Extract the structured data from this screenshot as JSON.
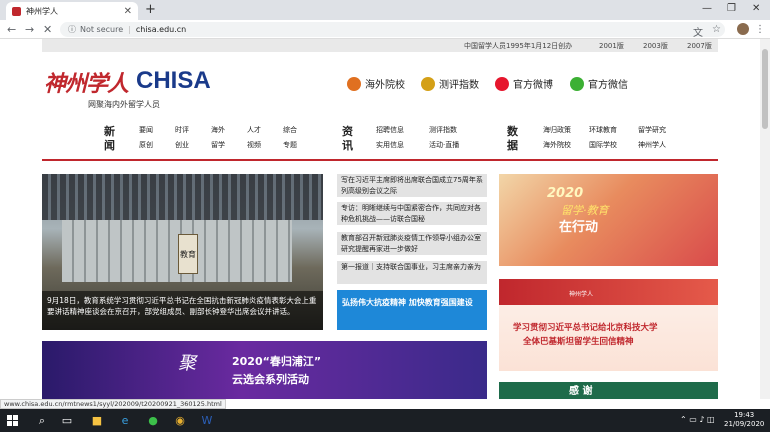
{
  "browser": {
    "tab_title": "神州学人",
    "url_secure_text": "Not secure",
    "url": "chisa.edu.cn",
    "status_url": "www.chisa.edu.cn/rmtnews1/syyl/202009/t20200921_360125.html"
  },
  "topbar": {
    "publication": "中国留学人员1995年1月12日创办",
    "versions": [
      "2001版",
      "2003版",
      "2007版"
    ]
  },
  "header": {
    "logo_cn": "神州学人",
    "logo_en": "CHISA",
    "slogan": "网聚海内外留学人员",
    "links": [
      {
        "label": "海外院校",
        "icon": "overseas-icon",
        "color": "#e07020"
      },
      {
        "label": "测评指数",
        "icon": "index-icon",
        "color": "#d4a017"
      },
      {
        "label": "官方微博",
        "icon": "weibo-icon",
        "color": "#e6162d"
      },
      {
        "label": "官方微信",
        "icon": "wechat-icon",
        "color": "#3cb034"
      }
    ]
  },
  "nav": {
    "news_head": "新闻",
    "news_items": [
      "要闻",
      "时评",
      "海外",
      "人才",
      "综合",
      "原创",
      "创业",
      "留学",
      "视频",
      "专题"
    ],
    "info_head": "资讯",
    "info_items": [
      "招聘信息",
      "测评指数",
      "实用信息",
      "活动·直播"
    ],
    "data_head": "数据",
    "data_items": [
      "海归政策",
      "环球教育",
      "留学研究",
      "海外院校",
      "国际学校",
      "神州学人"
    ]
  },
  "main": {
    "photo_caption": "9月18日，教育系统学习贯彻习近平总书记在全国抗击新冠肺炎疫情表彰大会上重要讲话精神座谈会在京召开，部党组成员、副部长钟登华出席会议并讲话。",
    "photo_sign": "教育",
    "headlines": [
      "写在习近平主席即将出席联合国成立75周年系列高级别会议之际",
      "专访：明晰继续与中国紧密合作，共同应对各种危机挑战——访联合国秘",
      "教育部召开新冠肺炎疫情工作领导小组办公室研究提醒再家进一步做好",
      "第一报道｜支持联合国事业，习主席亲力亲为"
    ],
    "headline_blue": "弘扬伟大抗疫精神 加快教育强国建设"
  },
  "banners": {
    "b1_year": "2020",
    "b1_line": "留学·教育",
    "b1_action": "在行动",
    "b2_top": "神州学人",
    "b2_line1": "学习贯彻习近平总书记给北京科技大学",
    "b2_line2": "全体巴基斯坦留学生回信精神",
    "b3_logo": "聚",
    "b3_line1": "2020“春归浦江”",
    "b3_line2": "云选会系列活动",
    "b4_text": "感 谢"
  },
  "taskbar": {
    "time": "19:43",
    "date": "21/09/2020"
  }
}
